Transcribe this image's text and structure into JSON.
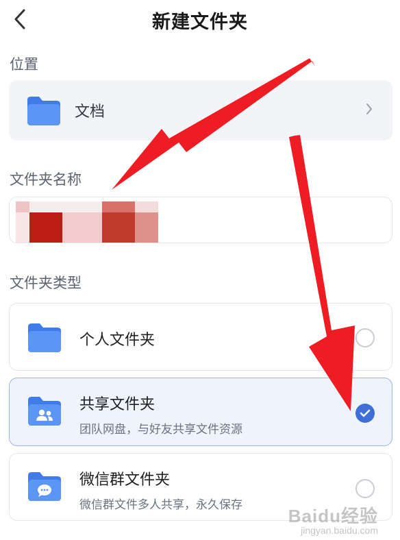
{
  "header": {
    "title": "新建文件夹"
  },
  "location": {
    "label": "位置",
    "folder_name": "文档"
  },
  "folder_name_field": {
    "label": "文件夹名称",
    "value": ""
  },
  "folder_type": {
    "label": "文件夹类型",
    "options": [
      {
        "name": "个人文件夹",
        "desc": "",
        "icon": "folder-icon",
        "selected": false
      },
      {
        "name": "共享文件夹",
        "desc": "团队网盘，与好友共享文件资源",
        "icon": "shared-folder-icon",
        "selected": true
      },
      {
        "name": "微信群文件夹",
        "desc": "微信群文件多人共享，永久保存",
        "icon": "wechat-folder-icon",
        "selected": false
      }
    ]
  },
  "colors": {
    "accent": "#3d6fd6",
    "folder": "#4a86f0",
    "arrow": "#ee1d24"
  },
  "watermark": {
    "main": "Baidu经验",
    "sub": "jingyan.baidu.com"
  }
}
